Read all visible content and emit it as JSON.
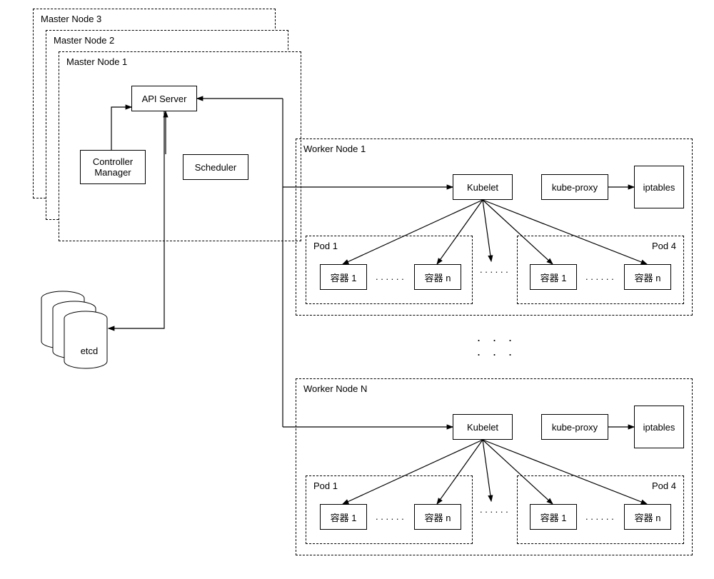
{
  "master": {
    "node1": "Master Node 1",
    "node2": "Master Node 2",
    "node3": "Master Node 3",
    "api_server": "API Server",
    "controller_manager": "Controller\nManager",
    "scheduler": "Scheduler"
  },
  "etcd": "etcd",
  "worker": {
    "node1_title": "Worker Node 1",
    "nodeN_title": "Worker Node N",
    "kubelet": "Kubelet",
    "kube_proxy": "kube-proxy",
    "iptables": "iptables",
    "pod1_title": "Pod 1",
    "pod4_title": "Pod 4",
    "container1": "容器 1",
    "containerN": "容器 n"
  },
  "ellipsis": ". . . . . ."
}
